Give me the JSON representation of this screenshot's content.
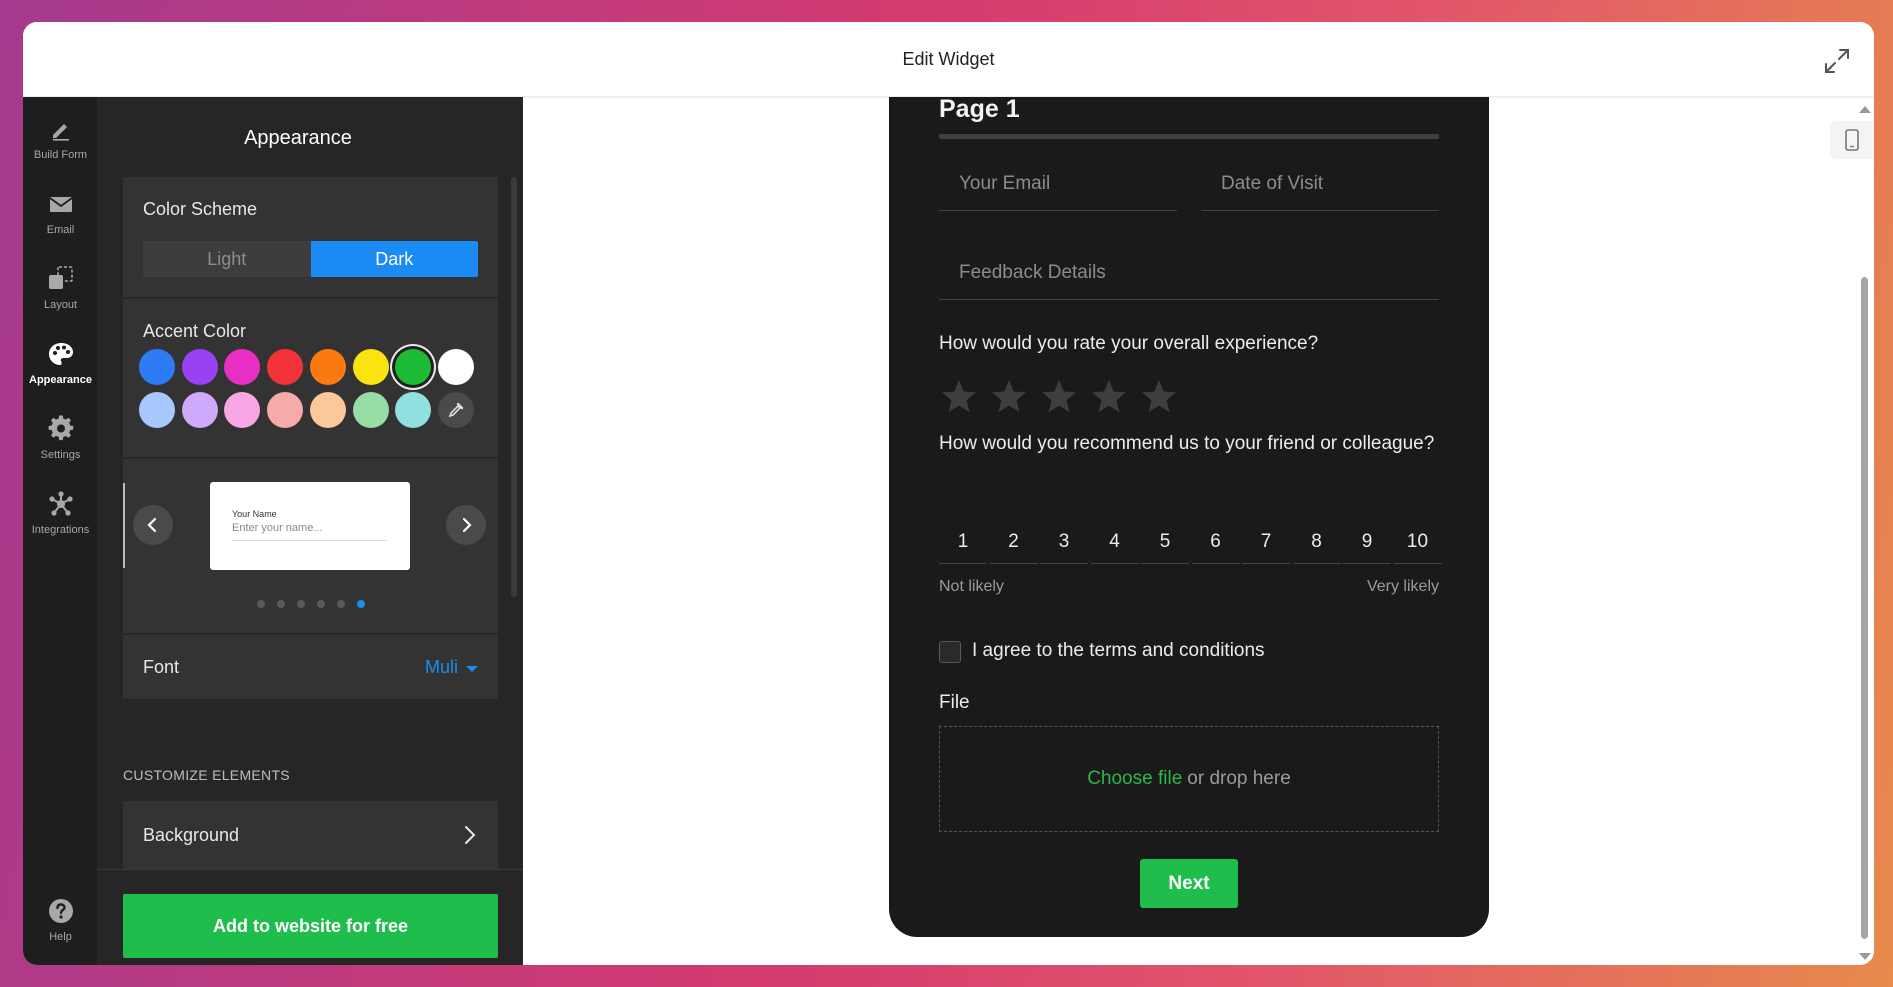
{
  "header": {
    "title": "Edit Widget"
  },
  "rail": {
    "items": [
      {
        "label": "Build Form",
        "icon": "pencil-icon"
      },
      {
        "label": "Email",
        "icon": "envelope-icon"
      },
      {
        "label": "Layout",
        "icon": "layout-icon"
      },
      {
        "label": "Appearance",
        "icon": "palette-icon",
        "active": true
      },
      {
        "label": "Settings",
        "icon": "gear-icon"
      },
      {
        "label": "Integrations",
        "icon": "integrations-icon"
      }
    ],
    "help_label": "Help"
  },
  "panel": {
    "title": "Appearance",
    "color_scheme": {
      "label": "Color Scheme",
      "light": "Light",
      "dark": "Dark",
      "selected": "Dark"
    },
    "accent": {
      "label": "Accent Color",
      "row1": [
        "#2d7cf6",
        "#9b41f5",
        "#e82fc4",
        "#f2343a",
        "#fa7a11",
        "#fbe312",
        "#1dbb35",
        "#ffffff"
      ],
      "row2": [
        "#a6c8ff",
        "#cfa9fb",
        "#f7a7e3",
        "#f8a9aa",
        "#fbc79b",
        "#97dda6",
        "#8fe0de"
      ],
      "selected": "#1dbb35"
    },
    "layout_preview": {
      "field_label": "Your Name",
      "field_placeholder": "Enter your name...",
      "dots_total": 6,
      "active_dot": 6
    },
    "font": {
      "label": "Font",
      "value": "Muli"
    },
    "customize_title": "CUSTOMIZE ELEMENTS",
    "background_label": "Background",
    "add_button": "Add to website for free"
  },
  "form": {
    "page_title": "Page 1",
    "email_placeholder": "Your Email",
    "date_placeholder": "Date of Visit",
    "feedback_placeholder": "Feedback Details",
    "rating_question": "How would you rate your overall experience?",
    "rating_stars": 5,
    "nps_question": "How would you recommend us to your friend or colleague?",
    "nps_values": [
      "1",
      "2",
      "3",
      "4",
      "5",
      "6",
      "7",
      "8",
      "9",
      "10"
    ],
    "nps_low": "Not likely",
    "nps_high": "Very likely",
    "terms_label": "I agree to the terms and conditions",
    "file_label": "File",
    "choose_file": "Choose file",
    "drop_text": "or drop here",
    "next_button": "Next"
  },
  "colors": {
    "accent_blue": "#1a8cf4",
    "accent_green": "#1fbd4b"
  }
}
